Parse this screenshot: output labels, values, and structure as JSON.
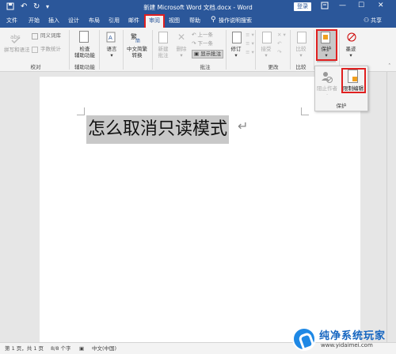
{
  "titlebar": {
    "doc_title": "新建 Microsoft Word 文档.docx  -  Word",
    "login_label": "登录",
    "quick_access": [
      "save-icon",
      "undo-icon",
      "redo-icon",
      "customize-icon"
    ],
    "window_controls": [
      "ribbon-display-icon",
      "minimize-icon",
      "maximize-icon",
      "close-icon"
    ]
  },
  "menu": {
    "tabs": [
      {
        "label": "文件"
      },
      {
        "label": "开始"
      },
      {
        "label": "插入"
      },
      {
        "label": "设计"
      },
      {
        "label": "布局"
      },
      {
        "label": "引用"
      },
      {
        "label": "邮件"
      },
      {
        "label": "审阅",
        "active": true
      },
      {
        "label": "视图"
      },
      {
        "label": "帮助"
      }
    ],
    "tell_me": "操作说明搜索",
    "share": "共享"
  },
  "ribbon": {
    "proofing": {
      "spelling": "拼写和语法",
      "thesaurus": "同义词库",
      "word_count": "字数统计",
      "group_label": "校对"
    },
    "accessibility": {
      "check": [
        "检查",
        "辅助功能"
      ],
      "group_label": "辅助功能"
    },
    "language": {
      "label": "语言"
    },
    "chinese": {
      "label": [
        "中文简繁",
        "转换"
      ]
    },
    "comments": {
      "new": [
        "新建",
        "批注"
      ],
      "delete": "删除",
      "prev": "上一条",
      "next": "下一条",
      "show": "显示批注",
      "group_label": "批注"
    },
    "tracking": {
      "track": "修订"
    },
    "changes": {
      "accept": "接受",
      "group_label": "更改"
    },
    "compare": {
      "label": "比较",
      "group_label": "比较"
    },
    "protect": {
      "label": "保护"
    },
    "ink": {
      "label": "墨迹"
    }
  },
  "flyout": {
    "block_authors": [
      "阻止作者",
      "·"
    ],
    "restrict_editing": "限制编辑",
    "group_label": "保护"
  },
  "document": {
    "text": "怎么取消只读模式"
  },
  "statusbar": {
    "page": "第 1 页，共 1 页",
    "words": "8/8 个字",
    "language": "中文(中国)"
  },
  "watermark": {
    "title": "纯净系统玩家",
    "url": "www.yidaimei.com"
  },
  "colors": {
    "accent": "#2b579a",
    "highlight_box": "#e02020",
    "selection": "#c8c8c8"
  }
}
